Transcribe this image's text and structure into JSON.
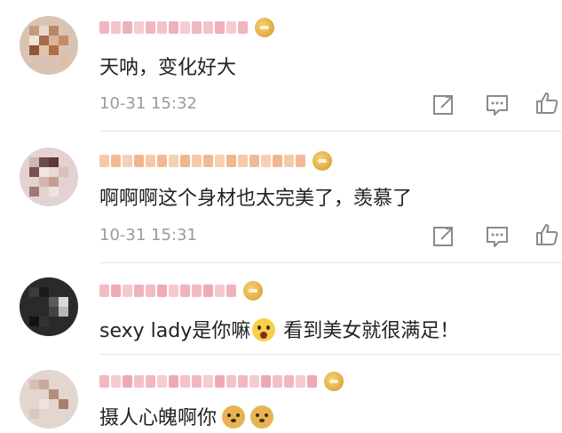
{
  "colors": {
    "text": "#222222",
    "time": "#9a9a9a",
    "divider": "#e6e6e6",
    "icon": "#8a8a8a"
  },
  "comments": [
    {
      "text": "天呐，变化好大",
      "time": "10-31 15:32",
      "actions": [
        "share-icon",
        "reply-icon",
        "like-icon"
      ]
    },
    {
      "text": "啊啊啊这个身材也太完美了，羡慕了",
      "time": "10-31 15:31",
      "actions": [
        "share-icon",
        "reply-icon",
        "like-icon"
      ]
    },
    {
      "text_a": "sexy lady是你嘛",
      "emoji_a": "scream-emoji",
      "text_b": " 看到美女就很满足！"
    },
    {
      "text": "摄人心魄啊你",
      "emojis": [
        "doge-emoji",
        "doge-emoji"
      ]
    }
  ]
}
